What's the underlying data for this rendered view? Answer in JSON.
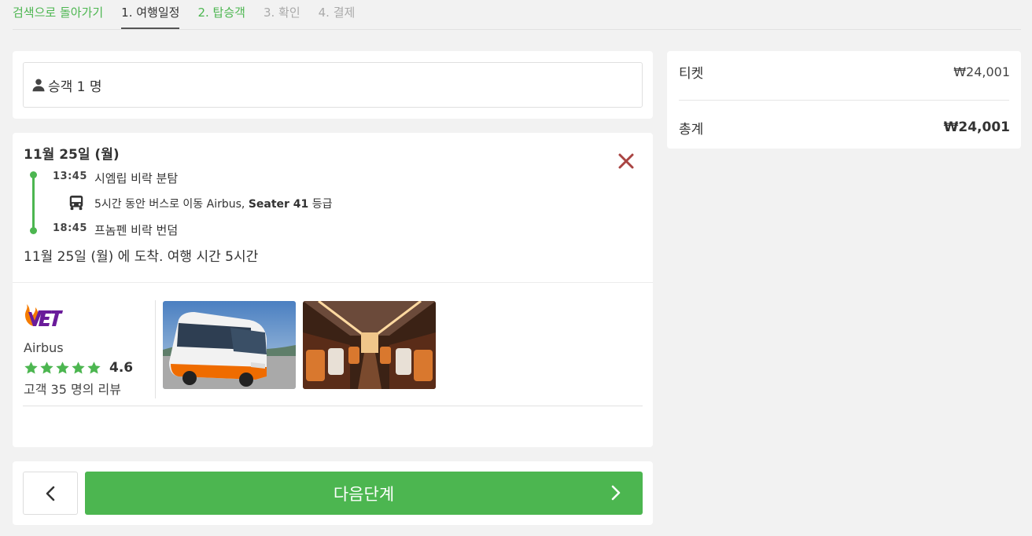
{
  "nav": {
    "back_label": "검색으로 돌아가기",
    "steps": [
      {
        "label": "1. 여행일정",
        "state": "active"
      },
      {
        "label": "2. 탑승객",
        "state": "done"
      },
      {
        "label": "3. 확인",
        "state": "todo"
      },
      {
        "label": "4. 결제",
        "state": "todo"
      }
    ]
  },
  "passengers": {
    "icon": "person-icon",
    "label": "승객 1 명"
  },
  "trip": {
    "date": "11월 25일 (월)",
    "departure": {
      "time": "13:45",
      "place": "시엠립 비락 분탐"
    },
    "travel": {
      "icon": "bus-icon",
      "text_before": "5시간 동안 버스로 이동 Airbus, ",
      "seat_class": "Seater 41",
      "text_after": " 등급"
    },
    "arrival_stop": {
      "time": "18:45",
      "place": "프놈펜 비락 번덤"
    },
    "arrival_note": "11월 25일 (월) 에 도착. 여행 시간 5시간"
  },
  "operator": {
    "logo_text": "VET",
    "name": "Airbus",
    "stars": 5,
    "rating": "4.6",
    "reviews": "고객 35 명의 리뷰"
  },
  "actions": {
    "next_label": "다음단계"
  },
  "summary": {
    "ticket_label": "티켓",
    "ticket_value": "₩24,001",
    "total_label": "총계",
    "total_value": "₩24,001"
  },
  "colors": {
    "accent": "#4cb650",
    "close": "#a94442",
    "logo_primary": "#6a1b9a",
    "logo_flame": "#f57c00"
  }
}
